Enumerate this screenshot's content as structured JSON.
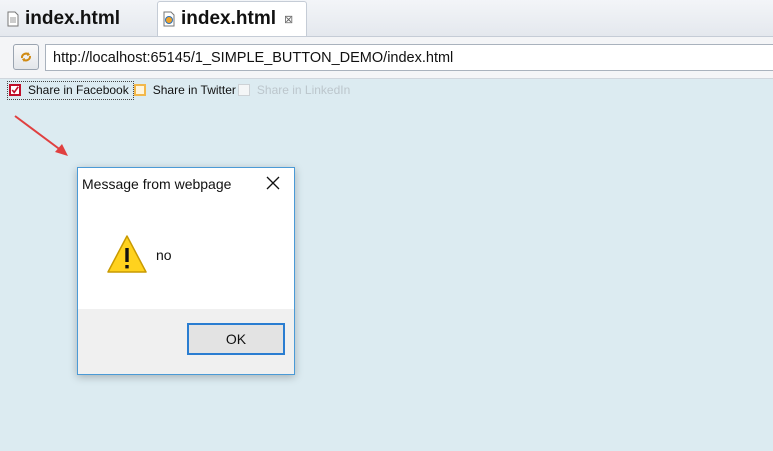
{
  "tabs": [
    {
      "label": "index.html"
    },
    {
      "label": "index.html",
      "close": "⊠"
    }
  ],
  "address": {
    "url": "http://localhost:65145/1_SIMPLE_BUTTON_DEMO/index.html"
  },
  "options": [
    {
      "label": "Share in Facebook",
      "checked": true
    },
    {
      "label": "Share in Twitter",
      "checked": false
    },
    {
      "label": "Share in LinkedIn",
      "checked": false,
      "disabled": true
    }
  ],
  "dialog": {
    "title": "Message from webpage",
    "message": "no",
    "ok_label": "OK"
  },
  "colors": {
    "page_bg": "#dcebf1",
    "accent_blue": "#2a7dd1",
    "check_red": "#c0102a",
    "arrow_red": "#e04040"
  }
}
